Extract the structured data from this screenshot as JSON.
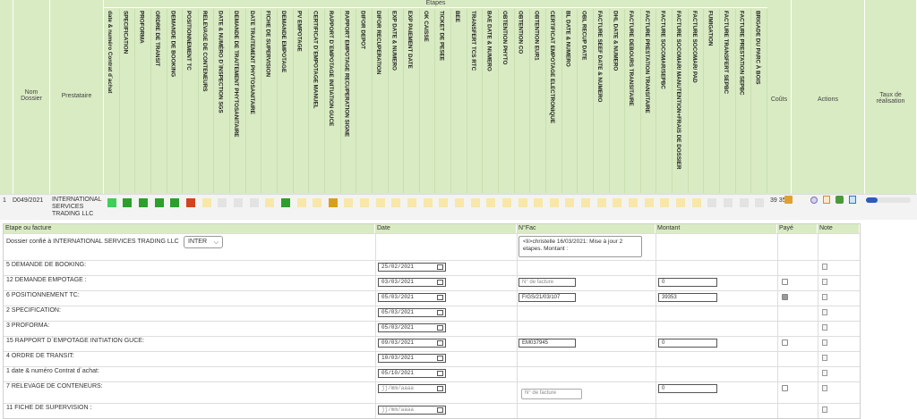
{
  "header": {
    "nom_dossier": "Nom Dossier",
    "prestataire": "Prestataire",
    "etapes": "Etapes",
    "couts": "Coûts",
    "actions": "Actions",
    "taux": "Taux de réalisation"
  },
  "etapes_columns": [
    "date & numéro Contrat d´achat",
    "SPECIFICATION",
    "PROFORMA",
    "ORDRE DE TRANSIT",
    "DEMANDE DE BOOKING",
    "POSITIONNEMENT TC",
    "RELEVAGE DE CONTENEURS",
    "DATE & NUMÉRO D´INSPECTION SGS",
    "DEMANDE DE TRAITEMENT PHYTOSANITAIRE",
    "DATE TRAITEMENT PHYTOSANITAIRE",
    "FICHE DE SUPERVISION",
    "DEMANDE EMPOTAGE",
    "PV EMPOTAGE",
    "CERTIFICAT D´EMPOTAGE MANUEL",
    "RAPPORT D´EMPOTAGE INITIATION GUCE",
    "RAPPORT EMPOTAGE RECUPERATION SIGNE",
    "DIFOR DEPOT",
    "DIFOR RECUPERATION",
    "EXP DATE & NUMERO",
    "EXP PAIEMENT DATE",
    "OK CAISSE",
    "TICKET DE PESEE",
    "BEE",
    "TRANSFERT TCS RTC",
    "BAE DATE & NUMERO",
    "OBTENTION PHYTO",
    "OBTENTION CO",
    "OBTENTION EUR1",
    "CERTIFICAT EMPOTAGE ELECTRONIQUE",
    "BL DATE & NUMERO",
    "OBL RECUP DATE",
    "FACTURE SEEF DATE & NUMERO",
    "DHL DATE & NUMERO",
    "FACTURE DEBOURS TRANSITAIRE",
    "FACTURE PRESTATION TRANSITAIRE",
    "FACTURE SOCOMAR/SEPBC",
    "FACTURE SOCOMAR/ MANUTENTION+FRAIS DE DOSSIER",
    "FACTURE SOCOMAR/ PAD",
    "FUMIGATION",
    "FACTURE TRANSFERT SEPBC",
    "FACTURE PRESTATION SEPBC",
    "BRIGADE DU PARC À BOIS"
  ],
  "row": {
    "index": "1",
    "dossier": "D049/2021",
    "prestataire_lines": [
      "INTERNATIONAL",
      "SERVICES",
      "TRADING LLC"
    ],
    "cout": "39 353",
    "taux_percent": 25,
    "statuses": [
      "lgreen",
      "green",
      "green",
      "green",
      "green",
      "red",
      "pale",
      "grey",
      "grey",
      "grey",
      "pale",
      "green",
      "pale",
      "pale",
      "orange",
      "pale",
      "pale",
      "pale",
      "pale",
      "pale",
      "pale",
      "pale",
      "pale",
      "pale",
      "pale",
      "pale",
      "pale",
      "pale",
      "pale",
      "pale",
      "pale",
      "pale",
      "pale",
      "pale",
      "pale",
      "pale",
      "pale",
      "pale",
      "grey",
      "grey",
      "grey",
      "grey"
    ]
  },
  "detail": {
    "headers": {
      "etape": "Etape ou facture",
      "date": "Date",
      "nfac": "N°Fac",
      "montant": "Montant",
      "paye": "Payé",
      "note": "Note"
    },
    "first_row": {
      "label": "Dossier confié à INTERNATIONAL SERVICES TRADING LLC",
      "select": "INTER",
      "note_text": "<li>christelle 16/03/2021: Mise à jour 2 etapes. Montant :"
    },
    "rows": [
      {
        "label": "5 DEMANDE DE BOOKING:",
        "date": "25/02/2021"
      },
      {
        "label": "12 DEMANDE EMPOTAGE :",
        "date": "03/03/2021",
        "nfac_placeholder": "N° de facture",
        "montant": "0",
        "paye": false
      },
      {
        "label": "6 POSITIONNEMENT TC:",
        "date": "05/03/2021",
        "nfac": "F/GS/21/03/107",
        "montant": "39353",
        "paye": true
      },
      {
        "label": "2 SPECIFICATION:",
        "date": "05/03/2021"
      },
      {
        "label": "3 PROFORMA:",
        "date": "05/03/2021"
      },
      {
        "label": "15 RAPPORT D´EMPOTAGE INITIATION GUCE:",
        "date": "09/03/2021",
        "nfac": "EM037945",
        "montant": "0",
        "paye": false
      },
      {
        "label": "4 ORDRE DE TRANSIT:",
        "date": "10/03/2021"
      },
      {
        "label": "1 date & numéro Contrat d´achat:",
        "date": "05/10/2021"
      },
      {
        "label": "7 RELEVAGE DE CONTENEURS:",
        "date_placeholder": "jj/mm/aaaa",
        "nfac_placeholder": "N° de facture",
        "montant": "0",
        "paye": false
      },
      {
        "label": "11 FICHE DE SUPERVISION :",
        "date_placeholder": "jj/mm/aaaa"
      }
    ]
  },
  "colors": {
    "header_bg": "#d9ebc3",
    "green": "#2ca02c",
    "red": "#d4431e",
    "orange": "#d9a017",
    "pale": "#f8e7a8",
    "progress": "#2b5cb8"
  }
}
